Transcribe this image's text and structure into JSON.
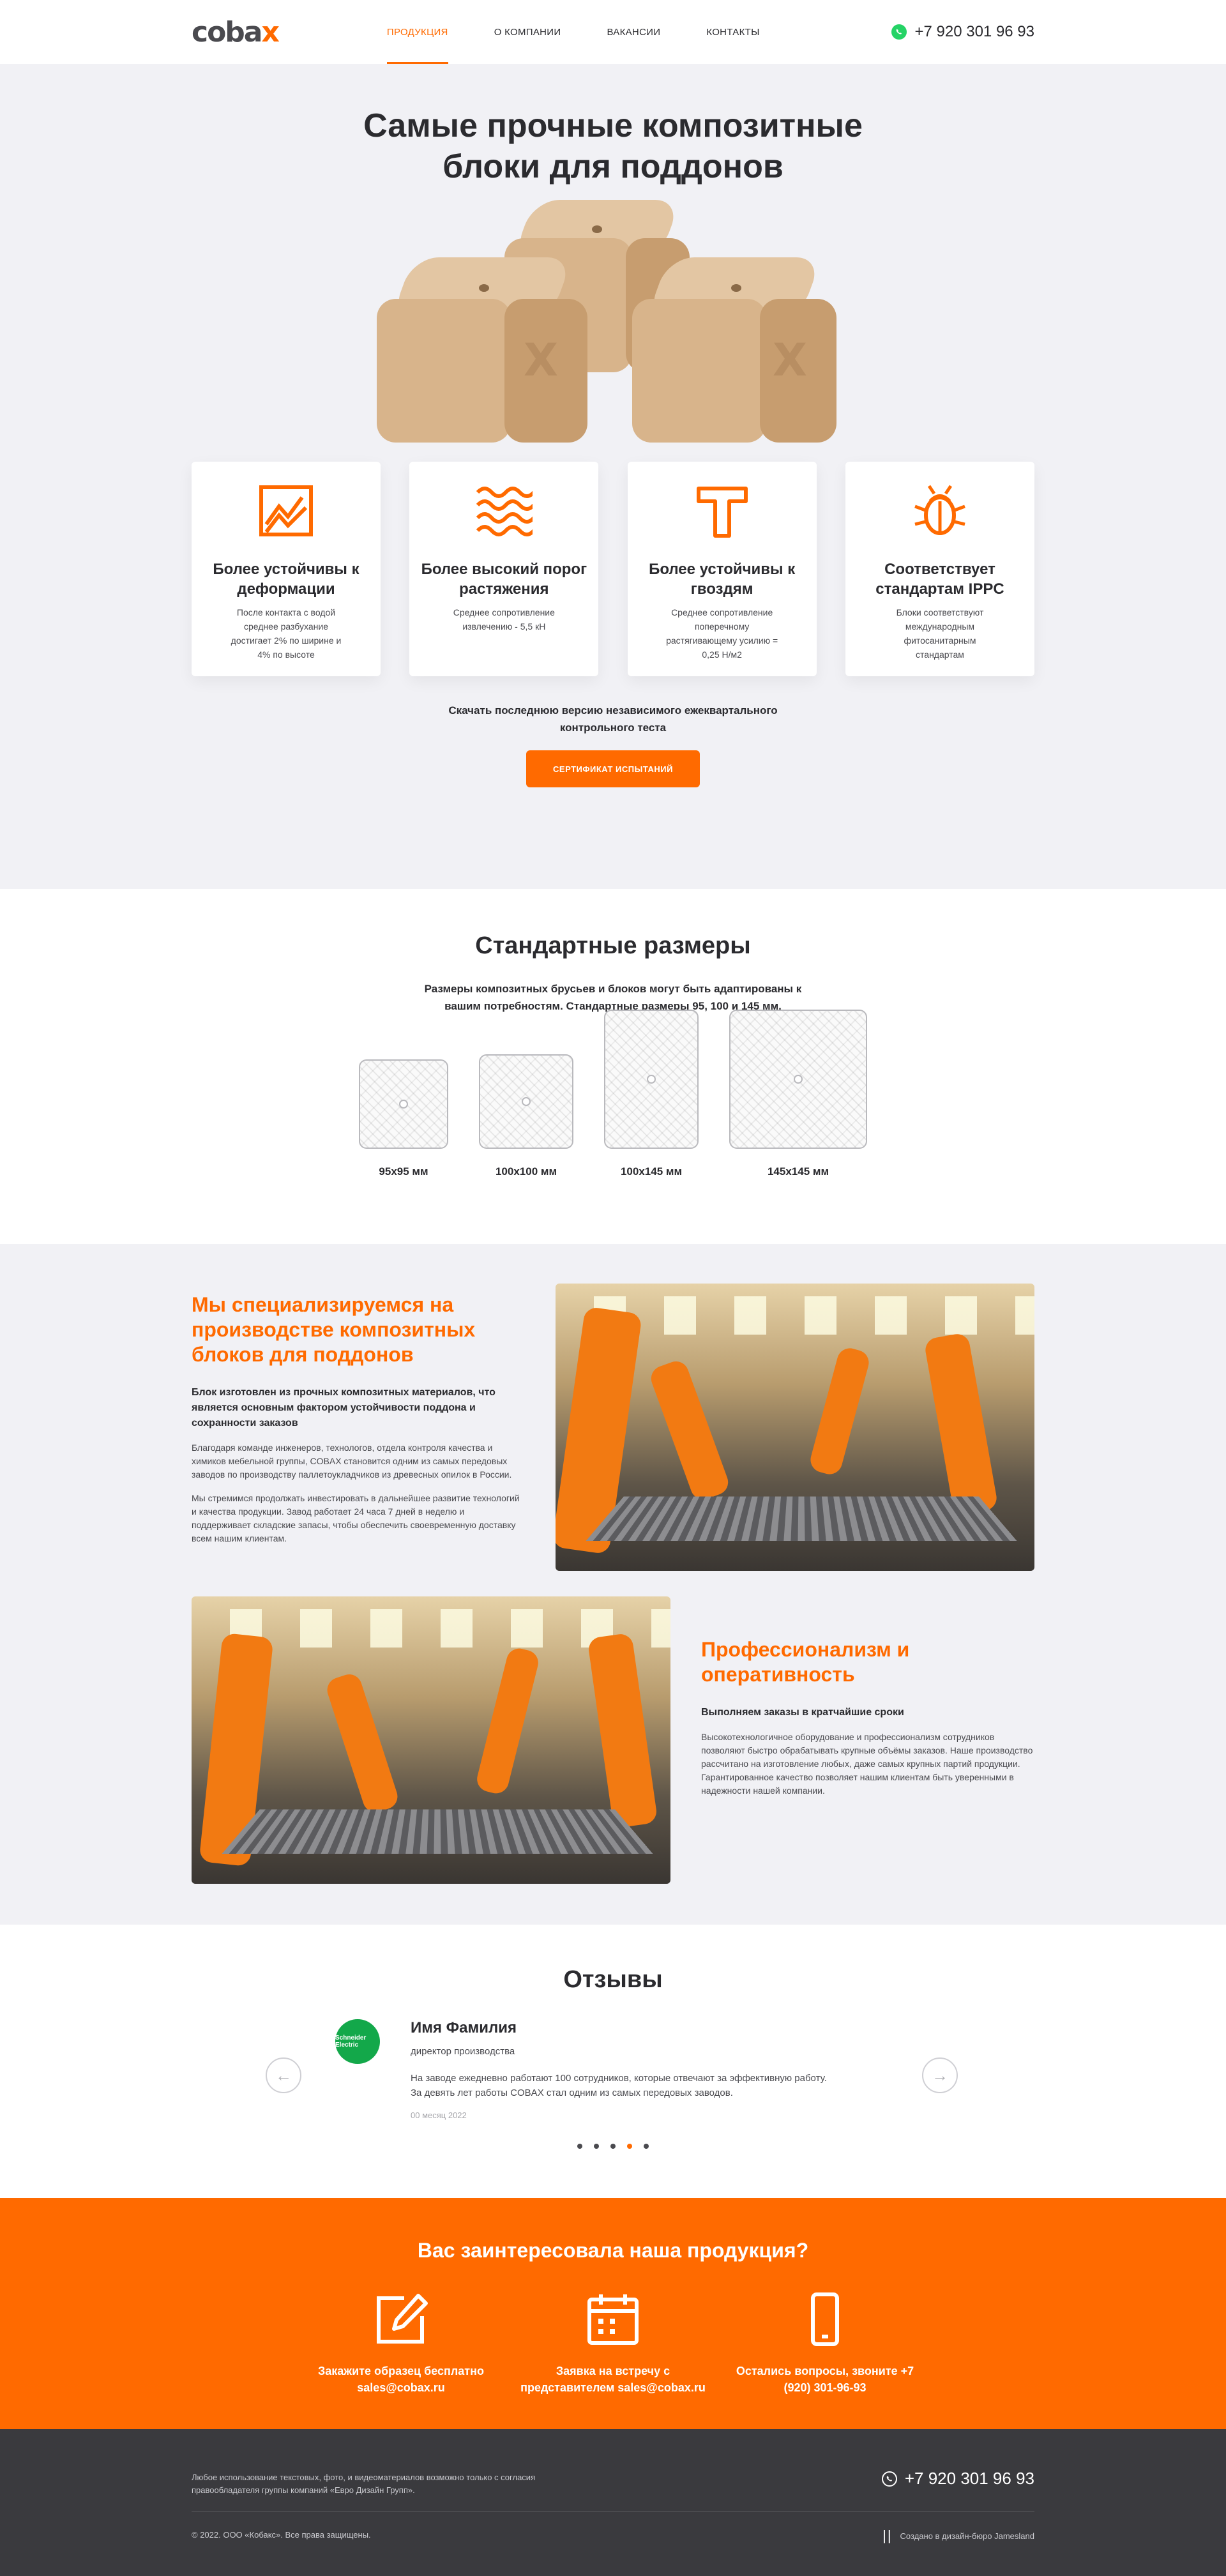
{
  "header": {
    "logo_main": "coba",
    "logo_accent": "x",
    "nav": [
      {
        "label": "Продукция"
      },
      {
        "label": "О компании"
      },
      {
        "label": "Вакансии"
      },
      {
        "label": "Контакты"
      }
    ],
    "phone": "+7 920 301 96 93"
  },
  "hero": {
    "title": "Самые прочные композитные блоки для поддонов",
    "block_mark": "X",
    "features": [
      {
        "icon": "chart-icon",
        "title": "Более устойчивы к деформации",
        "text": "После контакта с водой среднее разбухание достигает 2% по ширине и 4% по высоте"
      },
      {
        "icon": "waves-icon",
        "title": "Более высокий порог растяжения",
        "text": "Среднее сопротивление извлечению - 5,5 кН"
      },
      {
        "icon": "hammer-icon",
        "title": "Более устойчивы к гвоздям",
        "text": "Среднее сопротивление поперечному растягивающему усилию = 0,25 Н/м2"
      },
      {
        "icon": "bug-icon",
        "title": "Соответствует стандартам IPPC",
        "text": "Блоки соответствуют международным фитосанитарным стандартам"
      }
    ],
    "download_text": "Скачать последнюю версию независимого ежеквартального контрольного теста",
    "button_label": "Сертификат испытаний"
  },
  "sizes": {
    "title": "Стандартные размеры",
    "subtitle": "Размеры композитных брусьев и блоков могут быть адаптированы к вашим потребностям. Стандартные размеры 95, 100 и 145 мм.",
    "items": [
      {
        "label": "95x95 мм"
      },
      {
        "label": "100x100 мм"
      },
      {
        "label": "100x145 мм"
      },
      {
        "label": "145x145 мм"
      }
    ]
  },
  "about": {
    "block1": {
      "title": "Мы специализируемся на производстве композитных блоков для поддонов",
      "lead": "Блок изготовлен из прочных композитных материалов, что является основным фактором устойчивости поддона и сохранности заказов",
      "p1": "Благодаря команде инженеров, технологов, отдела контроля качества и химиков мебельной группы, COBAX становится одним из самых передовых заводов по производству паллетоукладчиков из древесных опилок в России.",
      "p2": "Мы стремимся продолжать инвестировать в дальнейшее развитие технологий и качества продукции. Завод работает 24 часа 7 дней в неделю и поддерживает складские запасы, чтобы обеспечить своевременную доставку всем нашим клиентам."
    },
    "block2": {
      "title": "Профессионализм и оперативность",
      "lead": "Выполняем заказы в кратчайшие сроки",
      "p1": "Высокотехнологичное оборудование и профессионализм сотрудников позволяют быстро обрабатывать крупные объёмы заказов. Наше производство рассчитано на изготовление любых, даже самых крупных партий продукции. Гарантированное качество позволяет нашим клиентам быть уверенными в надежности нашей компании."
    }
  },
  "reviews": {
    "title": "Отзывы",
    "avatar_text": "Schneider Electric",
    "name": "Имя Фамилия",
    "role": "директор производства",
    "text": "На заводе ежедневно работают 100 сотрудников, которые отвечают за эффективную работу. За девять лет работы COBAX стал одним из самых передовых заводов.",
    "date": "00 месяц 2022",
    "prev": "←",
    "next": "→",
    "active_dot": 3
  },
  "cta": {
    "title": "Вас заинтересовала наша продукция?",
    "items": [
      {
        "icon": "pencil-icon",
        "text": "Закажите образец бесплатно sales@cobax.ru"
      },
      {
        "icon": "calendar-icon",
        "text": "Заявка на встречу с представителем sales@cobax.ru"
      },
      {
        "icon": "phone-icon",
        "text": "Остались вопросы, звоните +7 (920) 301-96-93"
      }
    ]
  },
  "footer": {
    "note": "Любое использование текстовых, фото, и видеоматериалов возможно только с согласия правообладателя группы компаний «Евро Дизайн Групп».",
    "phone": "+7 920 301 96 93",
    "rights": "© 2022. ООО «Кобакс». Все права защищены.",
    "made": "Создано в дизайн-бюро Jamesland"
  },
  "colors": {
    "accent": "#ff6a00",
    "dark": "#3a3a3e",
    "light_bg": "#f1f1f5"
  }
}
